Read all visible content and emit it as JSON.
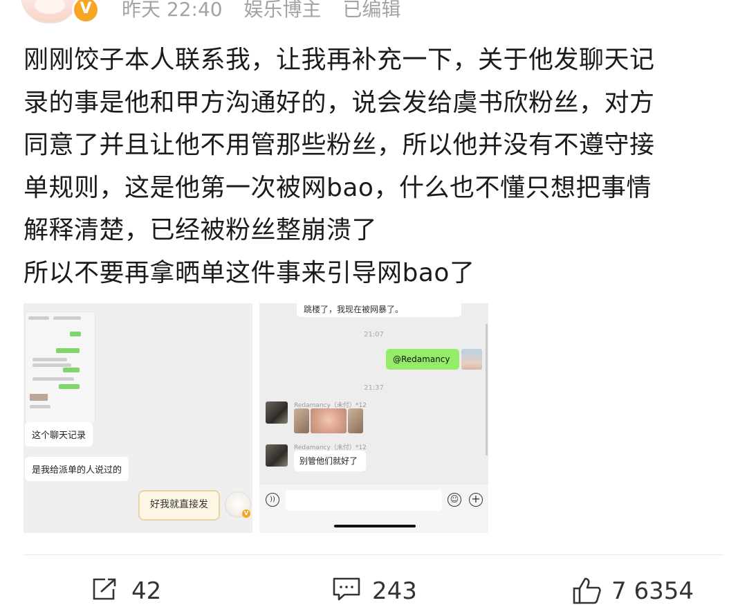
{
  "header": {
    "time": "昨天 22:40",
    "role": "娱乐博主",
    "edited": "已编辑",
    "verified_badge": "V"
  },
  "post": {
    "lines": [
      "刚刚饺子本人联系我，让我再补充一下，关于他发聊天记",
      "录的事是他和甲方沟通好的，说会发给虞书欣粉丝，对方",
      "同意了并且让他不用管那些粉丝，所以他并没有不遵守接",
      "单规则，这是他第一次被网bao，什么也不懂只想把事情",
      "解释清楚，已经被粉丝整崩溃了",
      "所以不要再拿晒单这件事来引导网bao了"
    ]
  },
  "image_left": {
    "bubble1": "这个聊天记录",
    "bubble2": "是我给派单的人说过的",
    "sticker_text": "好我就直接发"
  },
  "image_right": {
    "top_text": "跳楼了，我现在被网暴了。",
    "time1": "21:07",
    "mention": "@Redamancy",
    "time2": "21:37",
    "sender1": "Redamancy（未付）*12",
    "sender2": "Redamancy（未付）*12",
    "message": "别管他们就好了"
  },
  "footer": {
    "repost_count": "42",
    "comment_count": "243",
    "like_count": "7 6354"
  },
  "colors": {
    "meta_gray": "#a3a3a3",
    "wechat_green": "#95ec69",
    "badge_orange": "#f6a623"
  },
  "icons": [
    "repost-icon",
    "comment-icon",
    "like-icon",
    "voice-icon",
    "emoji-icon",
    "plus-icon"
  ]
}
